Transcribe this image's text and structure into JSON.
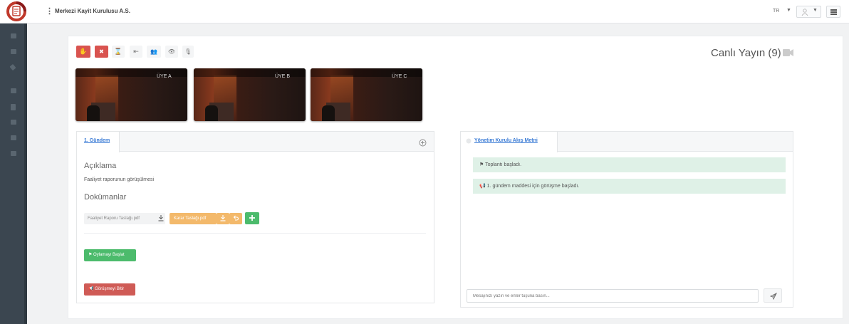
{
  "header": {
    "company": "Merkezi Kayit Kurulusu A.S.",
    "menu_glyph": "⋮",
    "lang": "TR",
    "lang_caret": "▼",
    "user_caret": "▼"
  },
  "toolbar": {
    "buttons": [
      {
        "name": "raise-hand",
        "glyph": "✋"
      },
      {
        "name": "close",
        "glyph": "✖"
      },
      {
        "name": "hourglass",
        "glyph": "⌛"
      },
      {
        "name": "sign-out",
        "glyph": "⇤"
      },
      {
        "name": "users",
        "glyph": "👥"
      },
      {
        "name": "eye",
        "glyph": "👁"
      },
      {
        "name": "microphone",
        "glyph": "🎙"
      }
    ],
    "live_label": "Canlı Yayın (9)"
  },
  "videos": [
    {
      "label": "ÜYE A"
    },
    {
      "label": "ÜYE B"
    },
    {
      "label": "ÜYE C"
    }
  ],
  "agenda": {
    "tab": "1. Gündem",
    "desc_title": "Açıklama",
    "desc_text": "Faaliyet raporunun görüşülmesi",
    "docs_title": "Dokümanlar",
    "doc1": "Faaliyet Raporu Taslağı.pdf",
    "doc2": "Karar Taslağı.pdf",
    "vote_button": "Oylamayı Başlat",
    "end_button": "Görüşmeyi Bitir"
  },
  "chat": {
    "tab": "Yönetim Kurulu Akış Metni",
    "messages": [
      {
        "text": "Toplantı başladı."
      },
      {
        "text": "1. gündem maddesi için görüşme başladı."
      }
    ],
    "input_placeholder": "Mesajınızı yazın ve enter tuşuna basın..."
  },
  "colors": {
    "sidebar": "#3b4650",
    "danger": "#d9534f",
    "success": "#4cbb6c",
    "warning": "#f3b96b",
    "link": "#3a7bd5",
    "message_bg": "#dff1e7"
  }
}
